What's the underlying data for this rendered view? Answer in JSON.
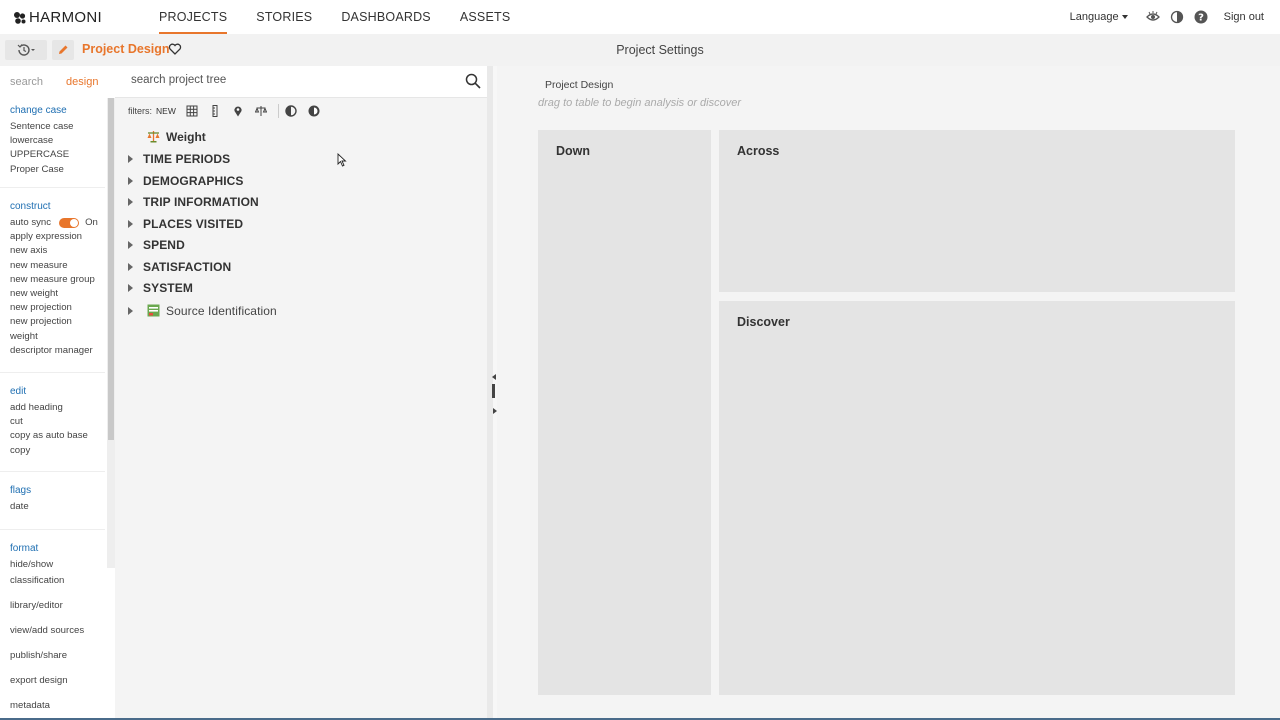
{
  "brand": {
    "name": "HARMONI"
  },
  "nav": {
    "items": [
      {
        "label": "PROJECTS",
        "active": true
      },
      {
        "label": "STORIES",
        "active": false
      },
      {
        "label": "DASHBOARDS",
        "active": false
      },
      {
        "label": "ASSETS",
        "active": false
      }
    ],
    "language_label": "Language",
    "signout_label": "Sign out"
  },
  "subheader": {
    "project_title": "Project Design",
    "settings_title": "Project Settings"
  },
  "sidebar": {
    "tabs": [
      {
        "label": "search",
        "active": false
      },
      {
        "label": "design",
        "active": true
      }
    ],
    "sections": [
      {
        "head": "change case",
        "items": [
          "Sentence case",
          "lowercase",
          "UPPERCASE",
          "Proper Case"
        ]
      },
      {
        "head": "construct",
        "auto_sync_label": "auto sync",
        "auto_sync_value": "On",
        "items": [
          "apply expression",
          "new axis",
          "new measure",
          "new measure group",
          "new weight",
          "new projection",
          "new projection weight",
          "descriptor manager"
        ]
      },
      {
        "head": "edit",
        "items": [
          "add heading",
          "cut",
          "copy as auto base",
          "copy"
        ]
      },
      {
        "head": "flags",
        "items": [
          "date"
        ]
      },
      {
        "head": "format",
        "items": [
          "hide/show"
        ]
      }
    ],
    "bottom_links": [
      "classification",
      "library/editor",
      "view/add sources",
      "publish/share",
      "export design",
      "metadata"
    ]
  },
  "tree_panel": {
    "search_placeholder": "search project tree",
    "filters_label": "filters:",
    "filters_new": "NEW",
    "weight_label": "Weight",
    "nodes": [
      "TIME PERIODS",
      "DEMOGRAPHICS",
      "TRIP INFORMATION",
      "PLACES VISITED",
      "SPEND",
      "SATISFACTION",
      "SYSTEM"
    ],
    "source_label": "Source Identification"
  },
  "canvas": {
    "title": "Project Design",
    "hint": "drag to table to begin analysis or discover",
    "zones": {
      "down": "Down",
      "across": "Across",
      "discover": "Discover"
    }
  },
  "colors": {
    "accent": "#e8762c",
    "link": "#1f6fb2",
    "zone": "#e4e4e4"
  }
}
